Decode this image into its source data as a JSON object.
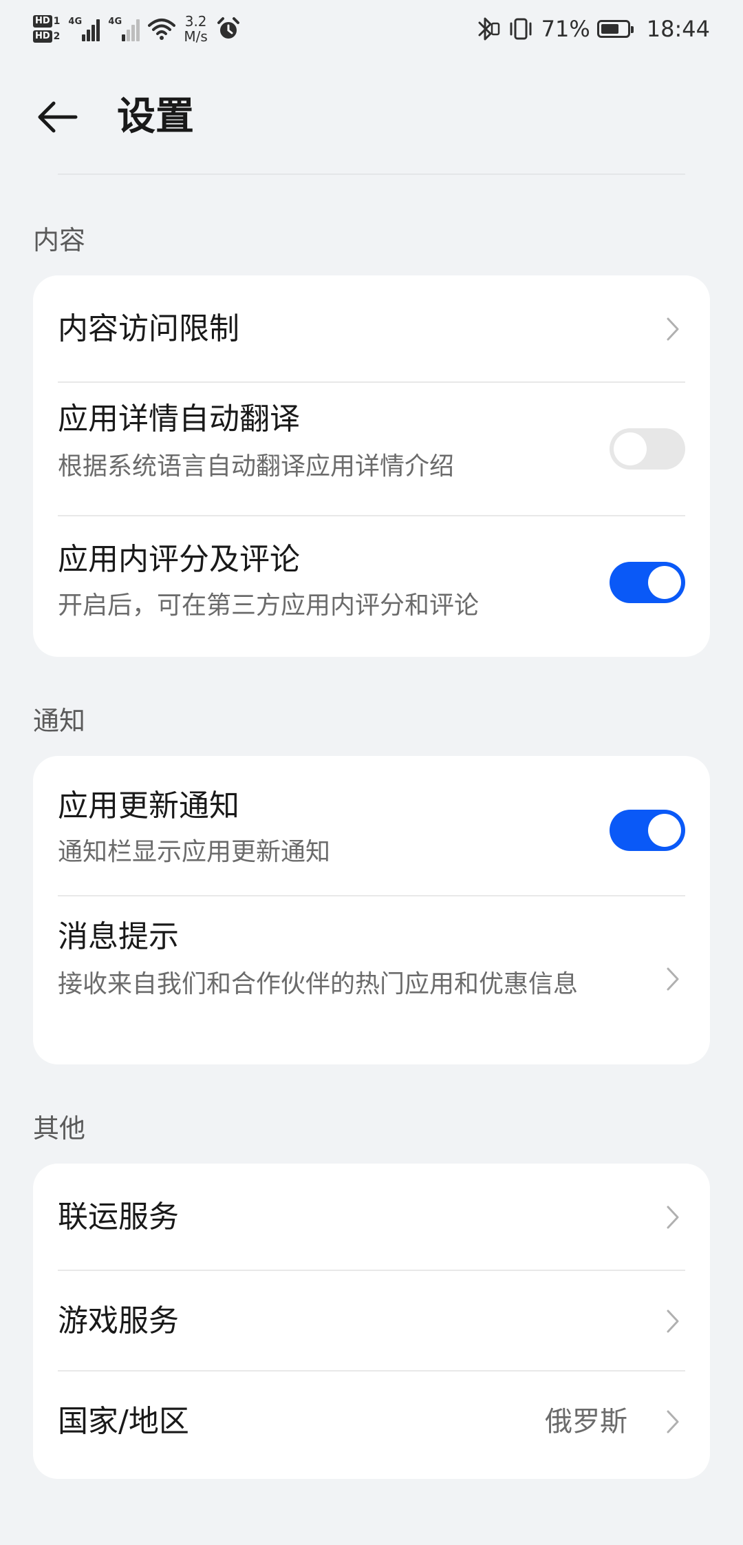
{
  "status_bar": {
    "sim1_label": "HD",
    "sim1_num": "1",
    "sim2_label": "HD",
    "sim2_num": "2",
    "net1": "4G",
    "net2": "4G",
    "speed_value": "3.2",
    "speed_unit": "M/s",
    "battery_percent": "71%",
    "battery_level": 0.71,
    "time": "18:44",
    "icons": [
      "wifi-icon",
      "alarm-icon",
      "bluetooth-icon",
      "vibrate-icon",
      "battery-icon"
    ]
  },
  "header": {
    "title": "设置",
    "back_icon": "back-arrow-icon"
  },
  "sections": {
    "content": {
      "label": "内容",
      "items": [
        {
          "title": "内容访问限制",
          "control": "chevron"
        },
        {
          "title": "应用详情自动翻译",
          "subtitle": "根据系统语言自动翻译应用详情介绍",
          "control": "toggle",
          "enabled": false
        },
        {
          "title": "应用内评分及评论",
          "subtitle": "开启后，可在第三方应用内评分和评论",
          "control": "toggle",
          "enabled": true
        }
      ]
    },
    "notify": {
      "label": "通知",
      "items": [
        {
          "title": "应用更新通知",
          "subtitle": "通知栏显示应用更新通知",
          "control": "toggle",
          "enabled": true
        },
        {
          "title": "消息提示",
          "subtitle": "接收来自我们和合作伙伴的热门应用和优惠信息",
          "control": "chevron"
        }
      ]
    },
    "other": {
      "label": "其他",
      "items": [
        {
          "title": "联运服务",
          "control": "chevron"
        },
        {
          "title": "游戏服务",
          "control": "chevron"
        },
        {
          "title": "国家/地区",
          "value": "俄罗斯",
          "control": "chevron"
        }
      ]
    }
  },
  "colors": {
    "background": "#f1f3f5",
    "card": "#ffffff",
    "accent": "#0a59f7",
    "toggle_off": "#e7e7e7",
    "text_primary": "#191919",
    "text_secondary": "#6b6b6b"
  }
}
